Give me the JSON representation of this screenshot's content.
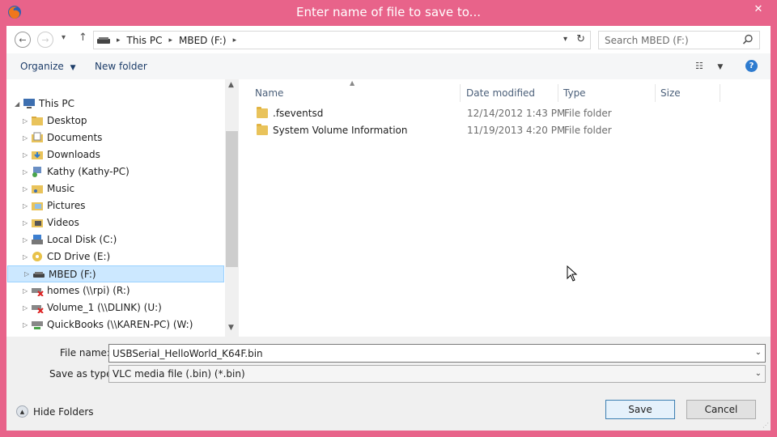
{
  "window": {
    "title": "Enter name of file to save to...",
    "close_glyph": "✕"
  },
  "nav": {
    "back_glyph": "←",
    "forward_glyph": "→",
    "recent_glyph": "▾",
    "up_glyph": "↑",
    "breadcrumbs": [
      "This PC",
      "MBED (F:)"
    ],
    "search_placeholder": "Search MBED (F:)"
  },
  "toolbar": {
    "organize": "Organize",
    "new_folder": "New folder",
    "help_glyph": "?"
  },
  "tree": {
    "items": [
      {
        "label": "This PC",
        "icon": "computer-icon",
        "level": 0,
        "expanded": true
      },
      {
        "label": "Desktop",
        "icon": "folder-icon",
        "level": 1
      },
      {
        "label": "Documents",
        "icon": "documents-icon",
        "level": 1
      },
      {
        "label": "Downloads",
        "icon": "downloads-icon",
        "level": 1
      },
      {
        "label": "Kathy (Kathy-PC)",
        "icon": "network-user-icon",
        "level": 1
      },
      {
        "label": "Music",
        "icon": "music-icon",
        "level": 1
      },
      {
        "label": "Pictures",
        "icon": "pictures-icon",
        "level": 1
      },
      {
        "label": "Videos",
        "icon": "videos-icon",
        "level": 1
      },
      {
        "label": "Local Disk (C:)",
        "icon": "local-disk-icon",
        "level": 1
      },
      {
        "label": "CD Drive (E:)",
        "icon": "cd-drive-icon",
        "level": 1
      },
      {
        "label": "MBED (F:)",
        "icon": "removable-drive-icon",
        "level": 1,
        "selected": true
      },
      {
        "label": "homes (\\\\rpi) (R:)",
        "icon": "disconnected-drive-icon",
        "level": 1
      },
      {
        "label": "Volume_1 (\\\\DLINK) (U:)",
        "icon": "disconnected-drive-icon",
        "level": 1
      },
      {
        "label": "QuickBooks (\\\\KAREN-PC) (W:)",
        "icon": "network-drive-icon",
        "level": 1
      }
    ]
  },
  "files": {
    "columns": [
      "Name",
      "Date modified",
      "Type",
      "Size"
    ],
    "rows": [
      {
        "name": ".fseventsd",
        "date": "12/14/2012 1:43 PM",
        "type": "File folder",
        "size": ""
      },
      {
        "name": "System Volume Information",
        "date": "11/19/2013 4:20 PM",
        "type": "File folder",
        "size": ""
      }
    ]
  },
  "form": {
    "file_name_label": "File name:",
    "file_name_value": "USBSerial_HelloWorld_K64F.bin",
    "save_type_label": "Save as type:",
    "save_type_value": "VLC media file (.bin) (*.bin)",
    "hide_folders": "Hide Folders",
    "save": "Save",
    "cancel": "Cancel"
  },
  "colors": {
    "accent": "#e8638a",
    "selection": "#cce8ff",
    "folder": "#e9c35b"
  }
}
